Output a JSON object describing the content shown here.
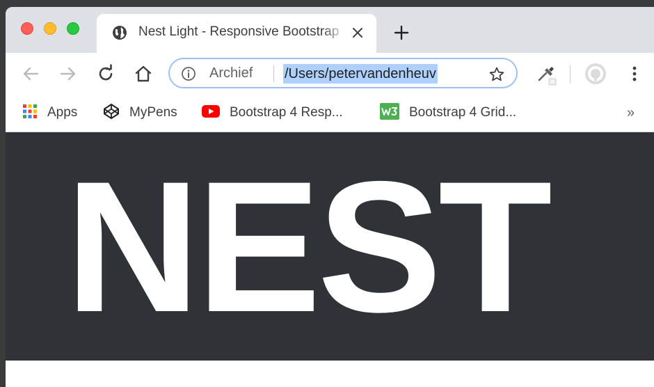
{
  "browser": {
    "tab": {
      "title": "Nest Light - Responsive Bootstrap",
      "icon": "globe-icon"
    },
    "omnibox": {
      "site_label": "Archief",
      "url": "/Users/petervandenheuv"
    },
    "bookmarks": [
      {
        "label": "Apps",
        "icon": "apps-grid-icon"
      },
      {
        "label": "MyPens",
        "icon": "codepen-icon"
      },
      {
        "label": "Bootstrap 4 Resp...",
        "icon": "youtube-icon"
      },
      {
        "label": "Bootstrap 4 Grid...",
        "icon": "w3schools-icon"
      }
    ],
    "bookmarks_overflow": "»"
  },
  "page": {
    "hero_title": "NEST"
  },
  "colors": {
    "hero_background": "#2f3338",
    "hero_text": "#ffffff",
    "tabstrip": "#dee1e6",
    "url_selection": "#aed0fb"
  }
}
